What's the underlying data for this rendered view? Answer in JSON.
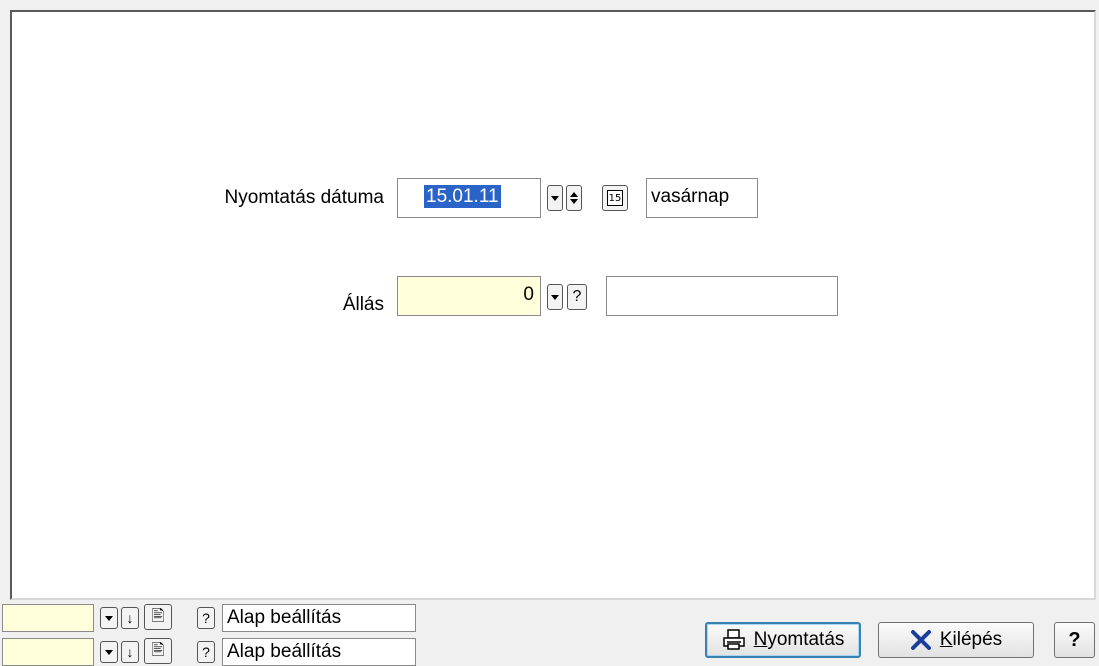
{
  "form": {
    "print_date": {
      "label": "Nyomtatás dátuma",
      "value": "15.01.11",
      "weekday": "vasárnap"
    },
    "position": {
      "label": "Állás",
      "value": "0",
      "description": "",
      "help_label": "?"
    }
  },
  "bottom_rows": [
    {
      "value": "",
      "help_label": "?",
      "preset": "Alap beállítás"
    },
    {
      "value": "",
      "help_label": "?",
      "preset": "Alap beállítás"
    }
  ],
  "buttons": {
    "print": {
      "underlined": "N",
      "rest": "yomtatás"
    },
    "exit": {
      "underlined": "K",
      "rest": "ilépés"
    },
    "help": "?"
  },
  "colors": {
    "required_field": "#ffffdc",
    "selection": "#2a64c8",
    "exit_icon": "#1a3e9c"
  }
}
